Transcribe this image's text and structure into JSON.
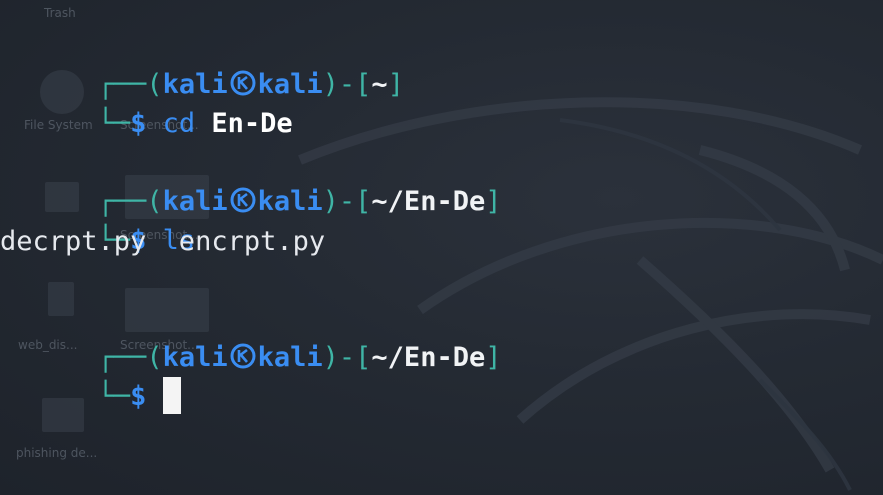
{
  "desktop": {
    "icons": [
      {
        "label": "Trash"
      },
      {
        "label": "File System"
      },
      {
        "label": "Screenshot..."
      },
      {
        "label": "Screenshot..."
      },
      {
        "label": "web_dis..."
      },
      {
        "label": "Screenshot..."
      },
      {
        "label": "phishing de..."
      }
    ]
  },
  "terminal": {
    "user": "kali",
    "host": "kali",
    "blocks": [
      {
        "path": "~",
        "prompt": "$",
        "command": "cd",
        "argument": "En-De",
        "output": ""
      },
      {
        "path": "~/En-De",
        "prompt": "$",
        "command": "ls",
        "argument": "",
        "output": "decrpt.py  encrpt.py"
      },
      {
        "path": "~/En-De",
        "prompt": "$",
        "command": "",
        "argument": "",
        "output": ""
      }
    ]
  },
  "colors": {
    "background": "#232830",
    "prompt_box": "#3fb5a6",
    "user_host": "#3a8df2",
    "text": "#e6e9ee"
  }
}
